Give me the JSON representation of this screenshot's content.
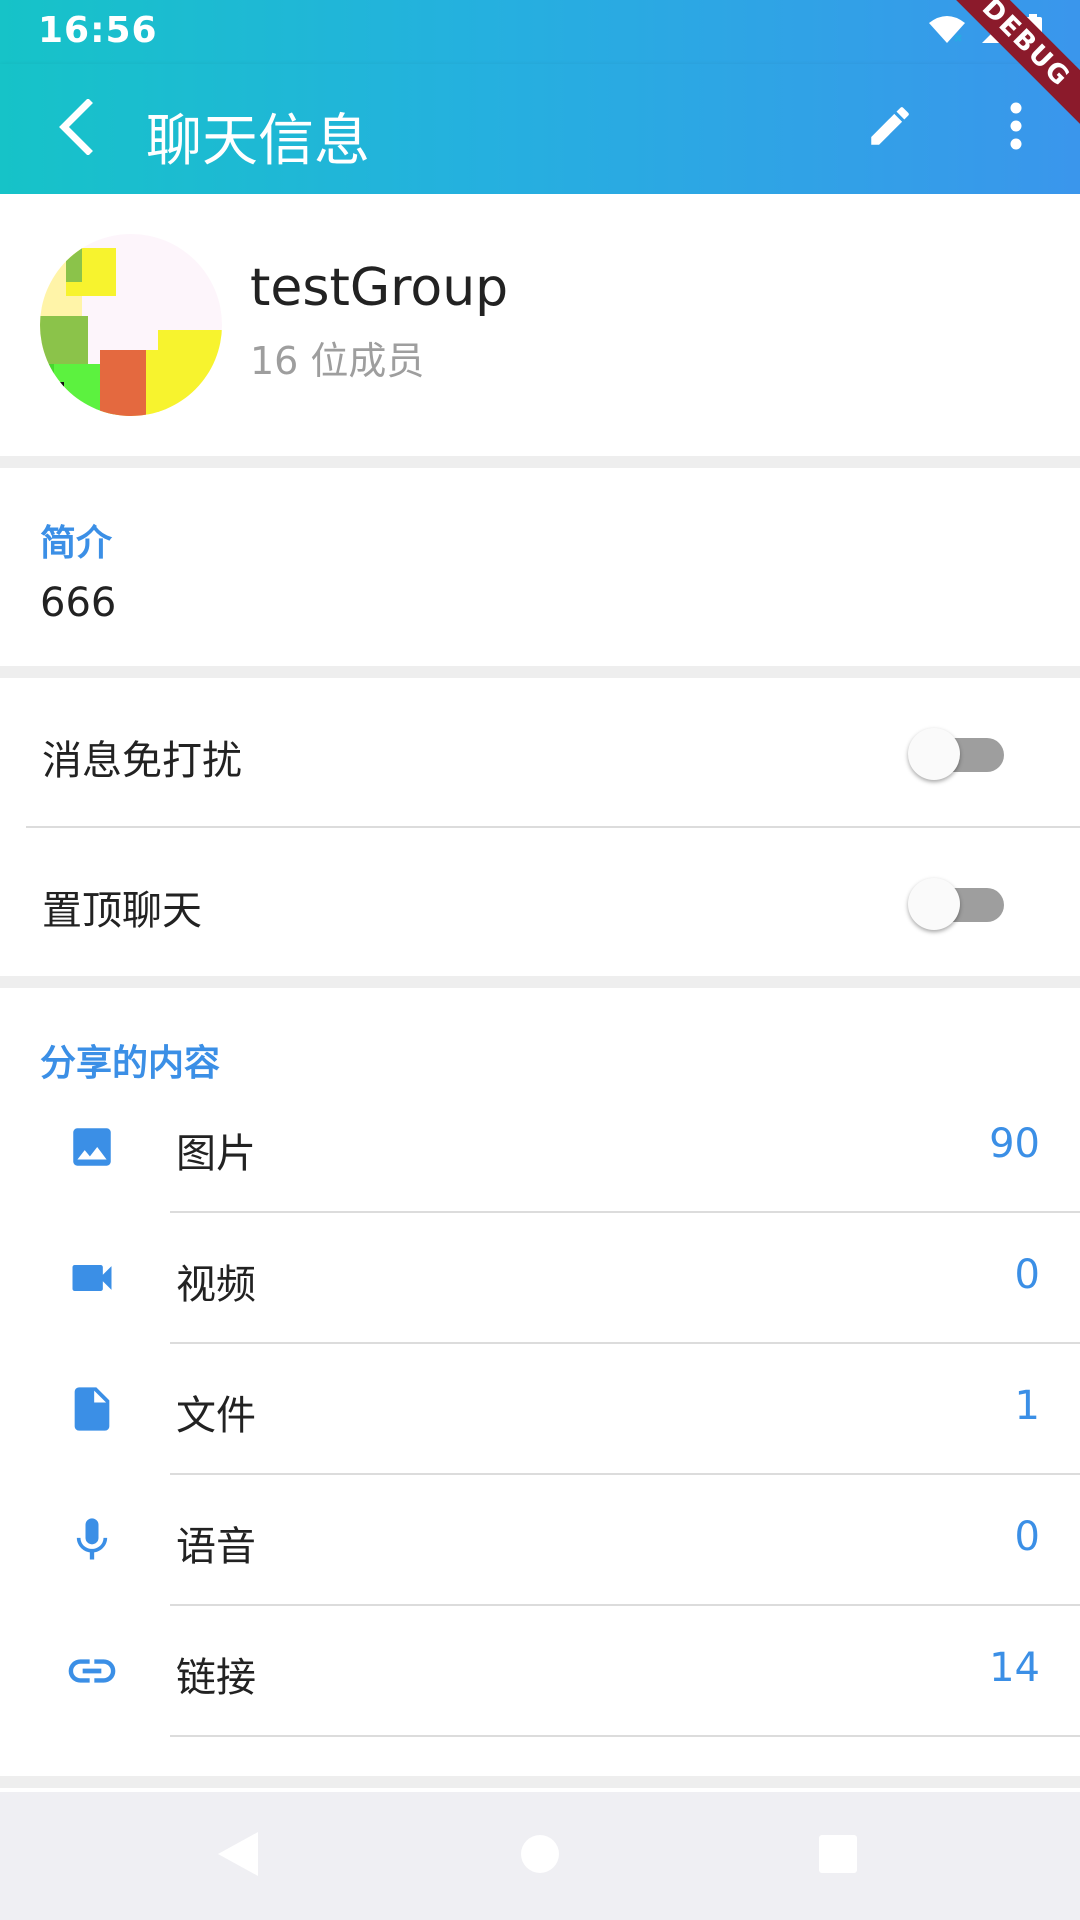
{
  "status_bar": {
    "time": "16:56"
  },
  "app_bar": {
    "title": "聊天信息",
    "back_icon": "arrow-back-icon",
    "edit_icon": "pencil-icon",
    "more_icon": "more-vert-icon",
    "debug_banner": "DEBUG"
  },
  "profile": {
    "name": "testGroup",
    "member_count": "16 位成员"
  },
  "intro": {
    "heading": "简介",
    "text": "666"
  },
  "toggles": [
    {
      "label": "消息免打扰",
      "on": false
    },
    {
      "label": "置顶聊天",
      "on": false
    }
  ],
  "shared": {
    "heading": "分享的内容",
    "items": [
      {
        "icon": "image-icon",
        "label": "图片",
        "count": "90"
      },
      {
        "icon": "videocam-icon",
        "label": "视频",
        "count": "0"
      },
      {
        "icon": "file-icon",
        "label": "文件",
        "count": "1"
      },
      {
        "icon": "mic-icon",
        "label": "语音",
        "count": "0"
      },
      {
        "icon": "link-icon",
        "label": "链接",
        "count": "14"
      }
    ]
  },
  "colors": {
    "accent": "#3b8fe6",
    "appbar_start": "#16c3c8",
    "appbar_end": "#3a96ec",
    "debug_ribbon": "#8b1a2b"
  }
}
